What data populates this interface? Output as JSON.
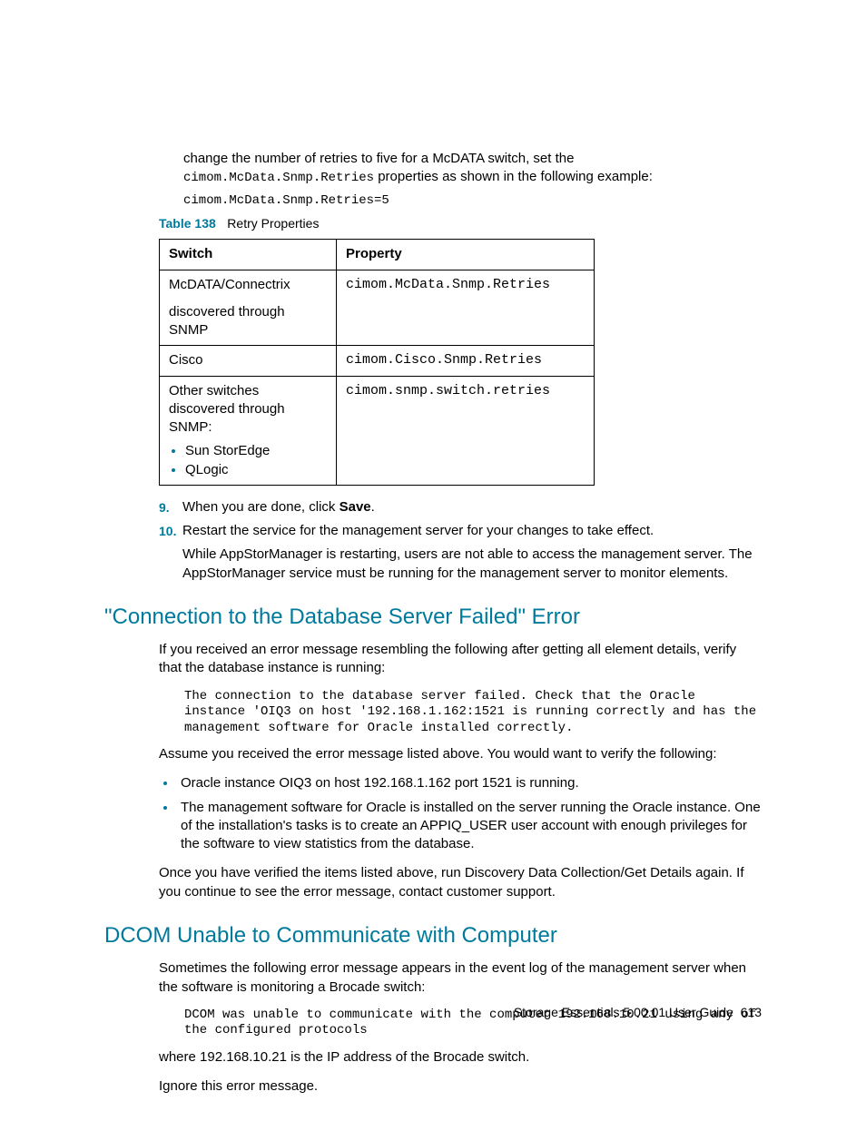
{
  "intro": {
    "line1": "change the number of retries to five for a McDATA switch, set the",
    "code_inline": "cimom.McData.Snmp.Retries",
    "line2": " properties as shown in the following example:",
    "example": "cimom.McData.Snmp.Retries=5"
  },
  "table": {
    "label": "Table 138",
    "name": "Retry Properties",
    "headers": [
      "Switch",
      "Property"
    ],
    "rows": [
      {
        "switch_main": "McDATA/Connectrix",
        "switch_sub": "discovered through SNMP",
        "property": "cimom.McData.Snmp.Retries"
      },
      {
        "switch_main": "Cisco",
        "property": "cimom.Cisco.Snmp.Retries"
      },
      {
        "switch_main": "Other switches discovered through SNMP:",
        "list": [
          "Sun StorEdge",
          "QLogic"
        ],
        "property": "cimom.snmp.switch.retries"
      }
    ]
  },
  "steps": {
    "s9": {
      "num": "9.",
      "pre": "When you are done, click ",
      "bold": "Save",
      "post": "."
    },
    "s10": {
      "num": "10.",
      "text": "Restart the service for the management server for your changes to take effect.",
      "note": "While AppStorManager is restarting, users are not able to access the management server. The AppStorManager service must be running for the management server to monitor elements."
    }
  },
  "section1": {
    "title": "\"Connection to the Database Server Failed\" Error",
    "p1": "If you received an error message resembling the following after getting all element details, verify that the database instance is running:",
    "code": "The connection to the database server failed. Check that the Oracle instance 'OIQ3 on host '192.168.1.162:1521 is running correctly and has the management software for Oracle installed correctly.",
    "p2": "Assume you received the error message listed above. You would want to verify the following:",
    "bullets": [
      "Oracle instance OIQ3 on host 192.168.1.162 port 1521 is running.",
      "The management software for Oracle is installed on the server running the Oracle instance. One of the installation's tasks is to create an APPIQ_USER user account with enough privileges for the software to view statistics from the database."
    ],
    "p3": "Once you have verified the items listed above, run Discovery Data Collection/Get Details again. If you continue to see the error message, contact customer support."
  },
  "section2": {
    "title": "DCOM Unable to Communicate with Computer",
    "p1": "Sometimes the following error message appears in the event log of the management server when the software is monitoring a Brocade switch:",
    "code": "DCOM was unable to communicate with the computer 192.168.10.21 using any of the configured protocols",
    "p2": "where 192.168.10.21 is the IP address of the Brocade switch.",
    "p3": "Ignore this error message."
  },
  "footer": {
    "text": "Storage Essentials 5.00.01 User Guide",
    "page": "613"
  }
}
